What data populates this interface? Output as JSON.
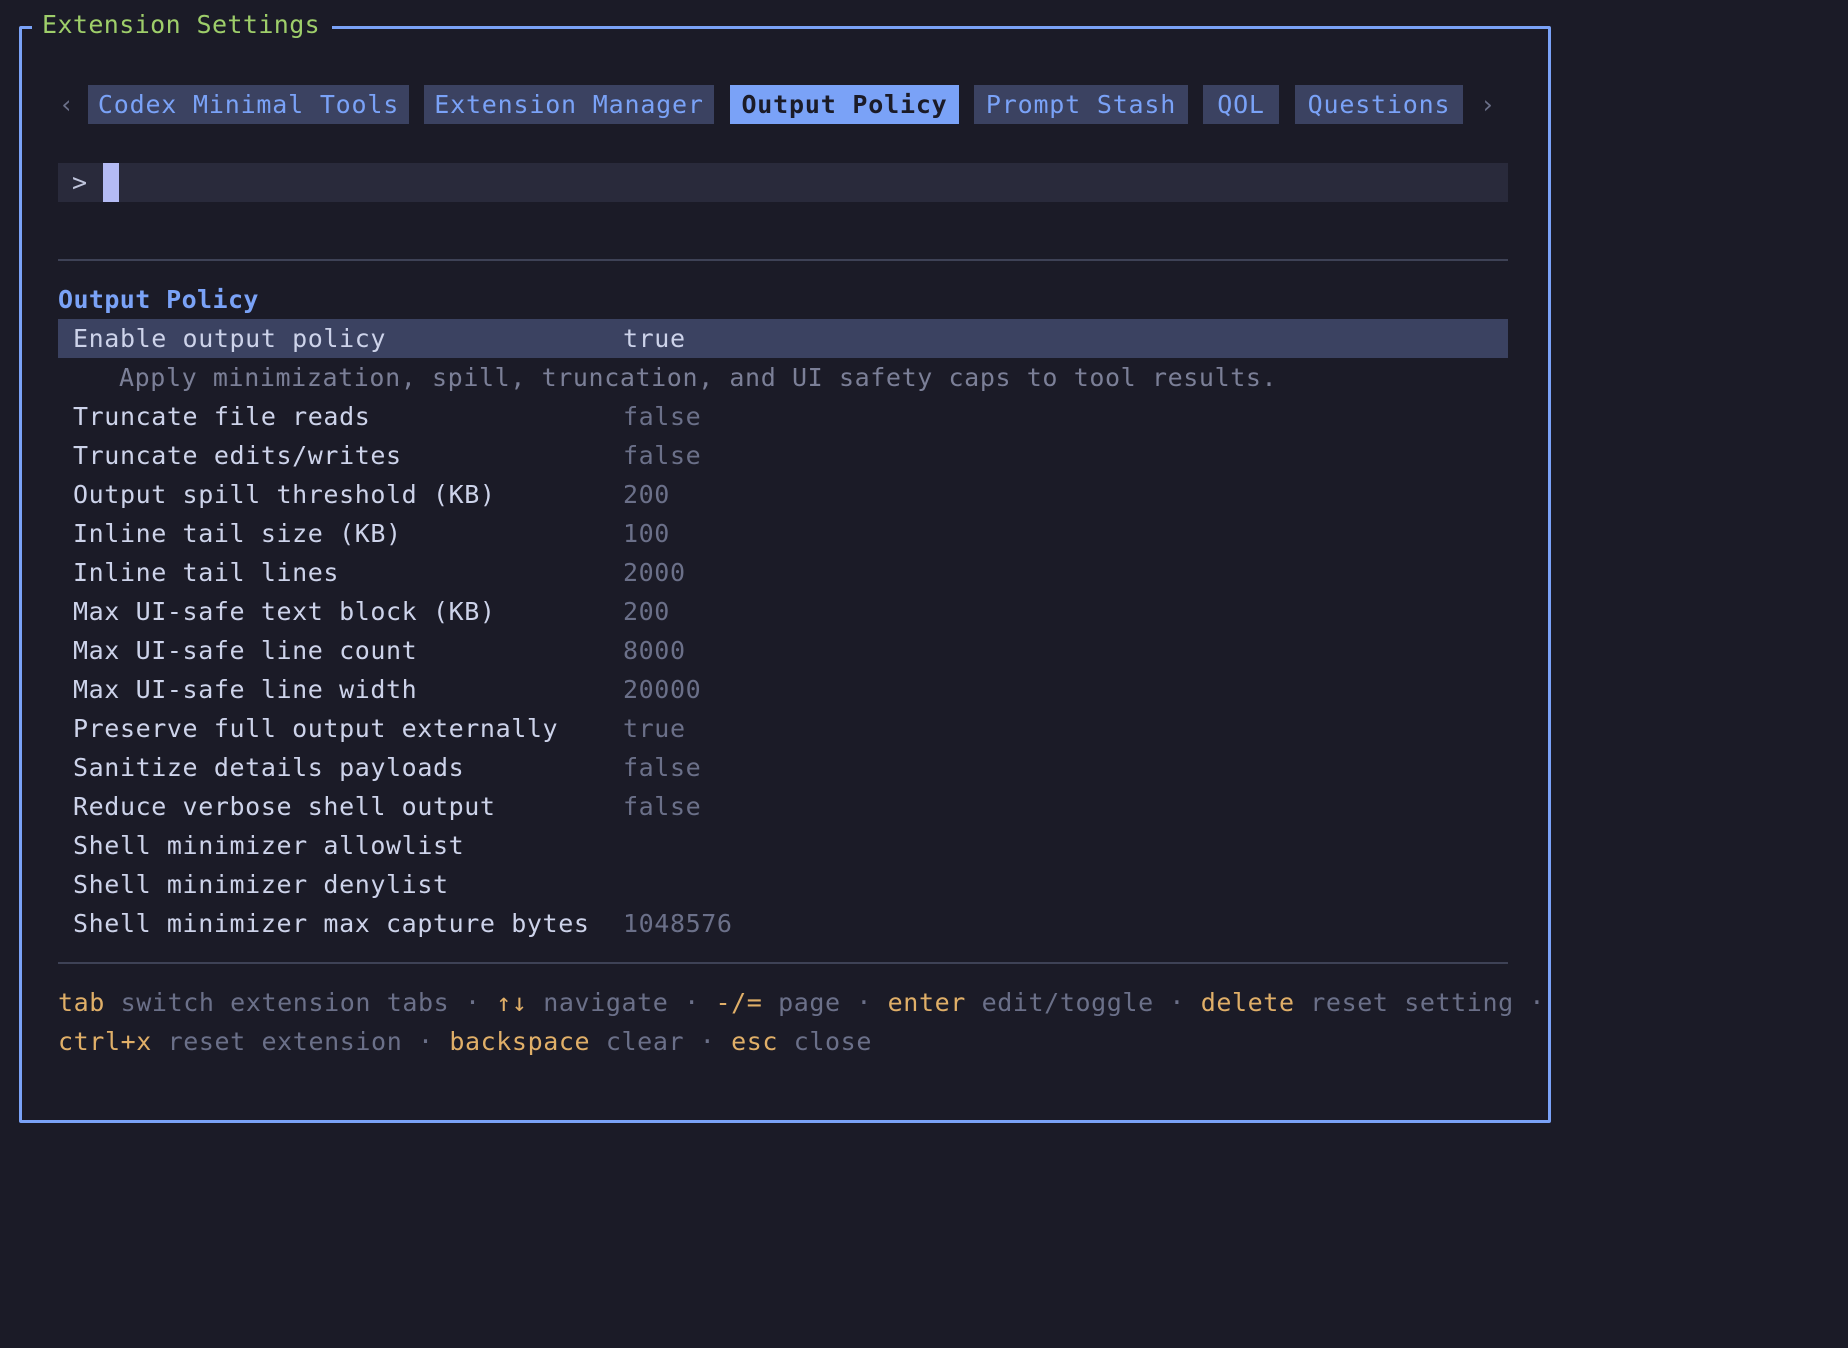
{
  "window": {
    "title": "Extension Settings"
  },
  "tabs": {
    "prev_arrow": "‹",
    "next_arrow": "›",
    "items": [
      {
        "label": "Codex Minimal Tools",
        "active": false
      },
      {
        "label": "Extension Manager",
        "active": false
      },
      {
        "label": "Output Policy",
        "active": true
      },
      {
        "label": "Prompt Stash",
        "active": false
      },
      {
        "label": "QOL",
        "active": false
      },
      {
        "label": "Questions",
        "active": false
      }
    ]
  },
  "search": {
    "prompt": ">",
    "value": "",
    "placeholder": ""
  },
  "section": {
    "title": "Output Policy"
  },
  "settings": [
    {
      "label": "Enable output policy",
      "value": "true",
      "selected": true,
      "description": "Apply minimization, spill, truncation, and UI safety caps to tool results."
    },
    {
      "label": "Truncate file reads",
      "value": "false"
    },
    {
      "label": "Truncate edits/writes",
      "value": "false"
    },
    {
      "label": "Output spill threshold (KB)",
      "value": "200"
    },
    {
      "label": "Inline tail size (KB)",
      "value": "100"
    },
    {
      "label": "Inline tail lines",
      "value": "2000"
    },
    {
      "label": "Max UI-safe text block (KB)",
      "value": "200"
    },
    {
      "label": "Max UI-safe line count",
      "value": "8000"
    },
    {
      "label": "Max UI-safe line width",
      "value": "20000"
    },
    {
      "label": "Preserve full output externally",
      "value": "true"
    },
    {
      "label": "Sanitize details payloads",
      "value": "false"
    },
    {
      "label": "Reduce verbose shell output",
      "value": "false"
    },
    {
      "label": "Shell minimizer allowlist",
      "value": ""
    },
    {
      "label": "Shell minimizer denylist",
      "value": ""
    },
    {
      "label": "Shell minimizer max capture bytes",
      "value": "1048576"
    }
  ],
  "help": {
    "separator": "·",
    "line1": [
      {
        "key": "tab",
        "text": "switch extension tabs"
      },
      {
        "key": "↑↓",
        "text": "navigate"
      },
      {
        "key": "-/=",
        "text": "page"
      },
      {
        "key": "enter",
        "text": "edit/toggle"
      },
      {
        "key": "delete",
        "text": "reset setting"
      }
    ],
    "line2": [
      {
        "key": "ctrl+x",
        "text": "reset extension"
      },
      {
        "key": "backspace",
        "text": "clear"
      },
      {
        "key": "esc",
        "text": "close"
      }
    ]
  },
  "colors": {
    "background": "#1b1b27",
    "border": "#7aa2f7",
    "title": "#9ece6a",
    "accent": "#7aa2f7",
    "tab_bg": "#3b4261",
    "key": "#e0af68",
    "muted": "#6b7089"
  }
}
